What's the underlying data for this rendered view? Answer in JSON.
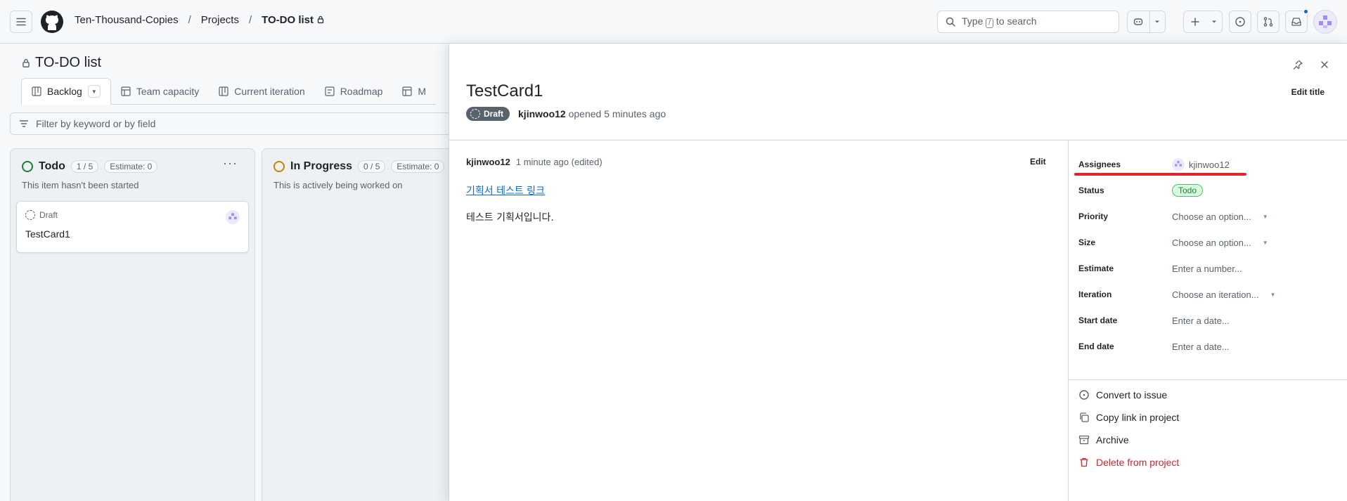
{
  "breadcrumb": {
    "org": "Ten-Thousand-Copies",
    "projects": "Projects",
    "current": "TO-DO list"
  },
  "search": {
    "prefix": "Type",
    "key": "/",
    "suffix": "to search"
  },
  "project": {
    "title": "TO-DO list",
    "tabs": [
      "Backlog",
      "Team capacity",
      "Current iteration",
      "Roadmap",
      "M"
    ],
    "filter_placeholder": "Filter by keyword or by field"
  },
  "columns": [
    {
      "name": "Todo",
      "count": "1 / 5",
      "estimate": "Estimate: 0",
      "description": "This item hasn't been started",
      "color": "#1a7f37",
      "cards": [
        {
          "status": "Draft",
          "title": "TestCard1"
        }
      ]
    },
    {
      "name": "In Progress",
      "count": "0 / 5",
      "estimate": "Estimate: 0",
      "description": "This is actively being worked on",
      "color": "#bf8700"
    }
  ],
  "panel": {
    "title": "TestCard1",
    "edit_title": "Edit title",
    "badge": "Draft",
    "author": "kjinwoo12",
    "opened_text": "opened 5 minutes ago",
    "comment": {
      "author": "kjinwoo12",
      "time": "1 minute ago (edited)",
      "edit_label": "Edit",
      "link_text": "기획서 테스트 링크",
      "body": "테스트 기획서입니다."
    },
    "fields": {
      "assignees": {
        "label": "Assignees",
        "value": "kjinwoo12"
      },
      "status": {
        "label": "Status",
        "value": "Todo"
      },
      "priority": {
        "label": "Priority",
        "value": "Choose an option..."
      },
      "size": {
        "label": "Size",
        "value": "Choose an option..."
      },
      "estimate": {
        "label": "Estimate",
        "value": "Enter a number..."
      },
      "iteration": {
        "label": "Iteration",
        "value": "Choose an iteration..."
      },
      "start_date": {
        "label": "Start date",
        "value": "Enter a date..."
      },
      "end_date": {
        "label": "End date",
        "value": "Enter a date..."
      }
    },
    "actions": {
      "convert": "Convert to issue",
      "copy_link": "Copy link in project",
      "archive": "Archive",
      "delete": "Delete from project"
    }
  },
  "colors": {
    "accent": "#0969da",
    "danger": "#d1242f",
    "annotation": "#e0242e"
  }
}
